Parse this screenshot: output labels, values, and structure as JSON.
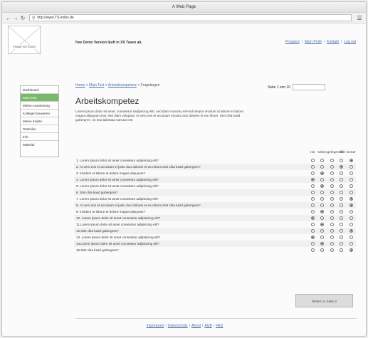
{
  "window": {
    "title": "A Web Page"
  },
  "browser": {
    "url": "http://www.TS-index.de",
    "back_icon": "back-arrow-icon",
    "forward_icon": "forward-arrow-icon",
    "reload_icon": "reload-icon",
    "menu_icon": "hamburger-menu-icon"
  },
  "header": {
    "logo_text": "Image not found",
    "demo_note": "free Demo Version läuft in XX Tasen ab.",
    "links": [
      "Prospect",
      "Mein Profil",
      "Kontakt",
      "Log out"
    ]
  },
  "sidebar": {
    "items": [
      {
        "label": "Dashboard",
        "active": false
      },
      {
        "label": "Mein Test",
        "active": true
      },
      {
        "label": "Meine Auswertung",
        "active": false
      },
      {
        "label": "Kollegen bewerten",
        "active": false
      },
      {
        "label": "Meine Inviste",
        "active": false
      },
      {
        "label": "Testreihe",
        "active": false
      },
      {
        "label": "Info",
        "active": false
      },
      {
        "label": "Material",
        "active": false
      }
    ]
  },
  "breadcrumb": {
    "items": [
      "Home",
      "Main Test",
      "Arbeitskompetenz"
    ],
    "current": "Fragebogen"
  },
  "pagination": {
    "label": "Seite 1 von 10"
  },
  "main": {
    "title": "Arbeitskompetez",
    "intro": "Lorem ipsum dolor sit amet, consetetur sadipscing elitr, sed diam nonumy eirmod tempor invidunt ut labore et dolore magna aliquyam erat, sed diam voluptua. At vero eos et accusam et justo duo dolores et ea rebum. Stet clita kasd gubergren, no sea takimata sanctus est"
  },
  "survey": {
    "options": [
      "nie",
      "selten",
      "gelegentlich",
      "oft",
      "immer"
    ],
    "questions": [
      {
        "text": "1. Lorem ipsum dolor sit amet consetetur adipisicing elit?",
        "selected": 4
      },
      {
        "text": "2. At vero eos et accusam et justo duo dolores et ea rebum.Stet clita kasd gubergren?",
        "selected": 3
      },
      {
        "text": "3. Invidunt ut labore et dolore magna aliquyam?",
        "selected": 1
      },
      {
        "text": "4. Lorem ipsum dolor sit amet consetetur adipisicing elit?",
        "selected": 0
      },
      {
        "text": "5. Lorem ipsum dolor sit amet consetetur adipisicing elit?",
        "selected": 1
      },
      {
        "text": "6. Stet clita kasd gubergren?",
        "selected": -1
      },
      {
        "text": "7. Lorem ipsum dolor sit amet consetetur adipisicing elit?",
        "selected": 4
      },
      {
        "text": "8. At vero eos et accusam et justo duo dolores et ea rebum.Stet clita kasd gubergren?",
        "selected": 4
      },
      {
        "text": "9. Invidunt ut labore et dolore magna aliquyam?",
        "selected": 1
      },
      {
        "text": "10. Lorem ipsum dolor sit amet consetetur adipisicing elit?",
        "selected": 0
      },
      {
        "text": "11.Lorem ipsum dolor sit amet consetetur adipisicing elit?",
        "selected": 1
      },
      {
        "text": "12.Stet clita kasd gubergren?",
        "selected": 4
      },
      {
        "text": "13. Lorem ipsum dolor sit amet consetetur adipisicing elit?",
        "selected": 0
      },
      {
        "text": "14.Lorem ipsum dolor sit amet consetetur adipisicing elit?",
        "selected": 1
      },
      {
        "text": "15.Stet clita kasd gubergren?",
        "selected": 4
      }
    ]
  },
  "actions": {
    "next_label": "Weiter zu Seite 2"
  },
  "footer": {
    "links": [
      "Impressum",
      "Datenschutz",
      "About",
      "AGB",
      "FAQ"
    ]
  }
}
